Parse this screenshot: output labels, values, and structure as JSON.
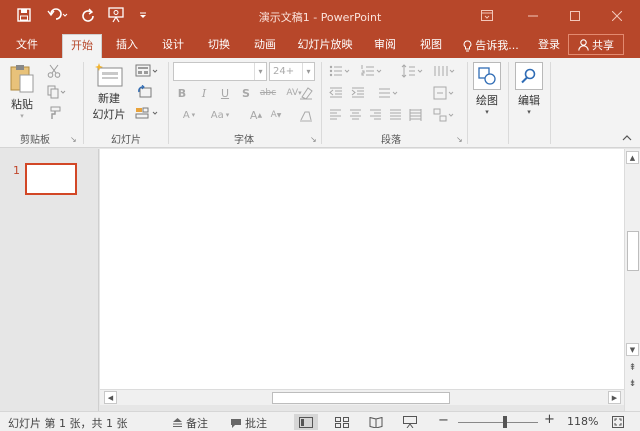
{
  "window": {
    "title": "演示文稿1 - PowerPoint",
    "quick_access": [
      "save-icon",
      "undo-icon",
      "redo-icon",
      "start-slideshow-icon",
      "customize-icon"
    ]
  },
  "tabs": [
    {
      "label": "文件"
    },
    {
      "label": "开始",
      "active": true
    },
    {
      "label": "插入"
    },
    {
      "label": "设计"
    },
    {
      "label": "切换"
    },
    {
      "label": "动画"
    },
    {
      "label": "幻灯片放映"
    },
    {
      "label": "审阅"
    },
    {
      "label": "视图"
    }
  ],
  "tell_me": "告诉我...",
  "login": "登录",
  "share": "共享",
  "ribbon": {
    "clipboard": {
      "paste": "粘贴",
      "group": "剪贴板"
    },
    "slides": {
      "new_line1": "新建",
      "new_line2": "幻灯片",
      "group": "幻灯片"
    },
    "font": {
      "font_name": "",
      "font_size": "24+",
      "bold": "B",
      "italic": "I",
      "underline": "U",
      "shadow": "S",
      "strike": "abc",
      "spacing": "AV",
      "color": "A",
      "change_case": "Aa",
      "grow": "A",
      "shrink": "A",
      "group": "字体"
    },
    "paragraph": {
      "group": "段落"
    },
    "drawing": {
      "label": "绘图"
    },
    "editing": {
      "label": "编辑"
    }
  },
  "thumbnails": [
    {
      "number": "1"
    }
  ],
  "status": {
    "slide_info": "幻灯片 第 1 张，共 1 张",
    "notes": "备注",
    "comments": "批注",
    "zoom_minus": "−",
    "zoom_plus": "+",
    "zoom": "118%",
    "zoom_fraction": 0.59
  },
  "colors": {
    "accent": "#b7472a",
    "selected_thumb": "#d24726"
  }
}
